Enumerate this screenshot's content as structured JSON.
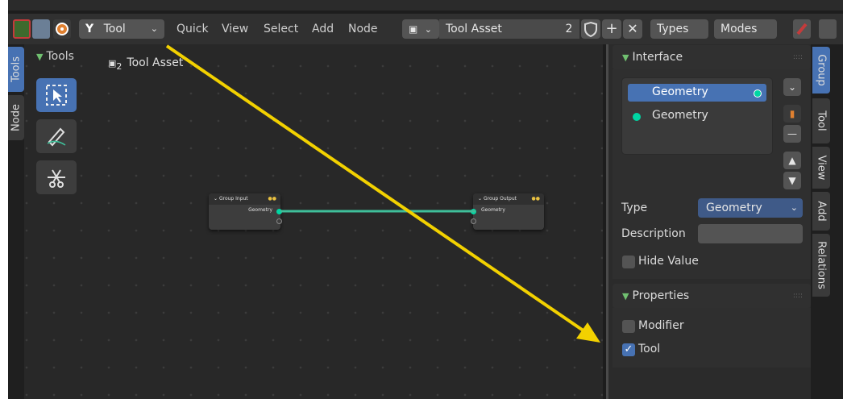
{
  "header": {
    "tool_label": "Tool",
    "menus": [
      "Quick",
      "View",
      "Select",
      "Add",
      "Node"
    ],
    "node_group_name": "Tool Asset",
    "user_count": "2",
    "types_label": "Types",
    "modes_label": "Modes"
  },
  "left_tabs": {
    "tools": "Tools",
    "node": "Node"
  },
  "toolbar": {
    "title": "Tools"
  },
  "breadcrumb": {
    "user_count": "2",
    "label": "Tool Asset"
  },
  "nodes": {
    "group_input": {
      "title": "Group Input",
      "socket": "Geometry"
    },
    "group_output": {
      "title": "Group Output",
      "socket": "Geometry"
    }
  },
  "interface_panel": {
    "title": "Interface",
    "items": [
      {
        "label": "Geometry",
        "kind": "output",
        "selected": true
      },
      {
        "label": "Geometry",
        "kind": "input",
        "selected": false
      }
    ],
    "type_label": "Type",
    "type_value": "Geometry",
    "description_label": "Description",
    "description_value": "",
    "hide_value_label": "Hide Value",
    "hide_value_checked": false
  },
  "properties_panel": {
    "title": "Properties",
    "modifier_label": "Modifier",
    "modifier_checked": false,
    "tool_label": "Tool",
    "tool_checked": true
  },
  "right_tabs": [
    "Group",
    "Tool",
    "View",
    "Add",
    "Relations"
  ],
  "colors": {
    "accent": "#4772b3",
    "geometry_socket": "#00d6a3",
    "arrow": "#f2d100",
    "link": "#3fbf9a"
  }
}
